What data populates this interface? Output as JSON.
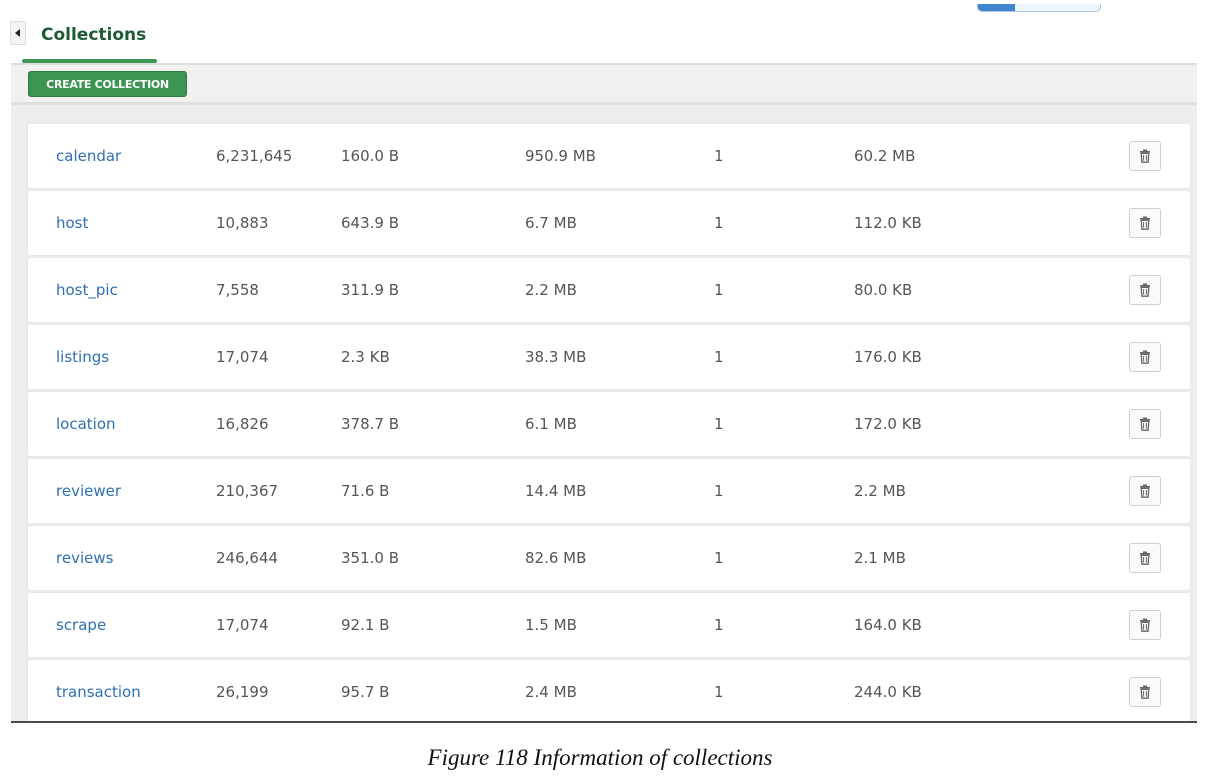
{
  "page": {
    "tab_title": "Collections",
    "create_button_label": "CREATE COLLECTION",
    "caption": "Figure 118 Information of collections"
  },
  "colors": {
    "accent_green": "#3b9550",
    "link_blue": "#2f6fb0",
    "progress_blue": "#3f86cc"
  },
  "icons": {
    "collapse": "caret-left-icon",
    "delete": "trash-icon"
  },
  "progress": {
    "fraction": 0.3
  },
  "collections": [
    {
      "name": "calendar",
      "c1": "6,231,645",
      "c2": "160.0 B",
      "c3": "950.9 MB",
      "c4": "1",
      "c5": "60.2 MB"
    },
    {
      "name": "host",
      "c1": "10,883",
      "c2": "643.9 B",
      "c3": "6.7 MB",
      "c4": "1",
      "c5": "112.0 KB"
    },
    {
      "name": "host_pic",
      "c1": "7,558",
      "c2": "311.9 B",
      "c3": "2.2 MB",
      "c4": "1",
      "c5": "80.0 KB"
    },
    {
      "name": "listings",
      "c1": "17,074",
      "c2": "2.3 KB",
      "c3": "38.3 MB",
      "c4": "1",
      "c5": "176.0 KB"
    },
    {
      "name": "location",
      "c1": "16,826",
      "c2": "378.7 B",
      "c3": "6.1 MB",
      "c4": "1",
      "c5": "172.0 KB"
    },
    {
      "name": "reviewer",
      "c1": "210,367",
      "c2": "71.6 B",
      "c3": "14.4 MB",
      "c4": "1",
      "c5": "2.2 MB"
    },
    {
      "name": "reviews",
      "c1": "246,644",
      "c2": "351.0 B",
      "c3": "82.6 MB",
      "c4": "1",
      "c5": "2.1 MB"
    },
    {
      "name": "scrape",
      "c1": "17,074",
      "c2": "92.1 B",
      "c3": "1.5 MB",
      "c4": "1",
      "c5": "164.0 KB"
    },
    {
      "name": "transaction",
      "c1": "26,199",
      "c2": "95.7 B",
      "c3": "2.4 MB",
      "c4": "1",
      "c5": "244.0 KB"
    }
  ]
}
